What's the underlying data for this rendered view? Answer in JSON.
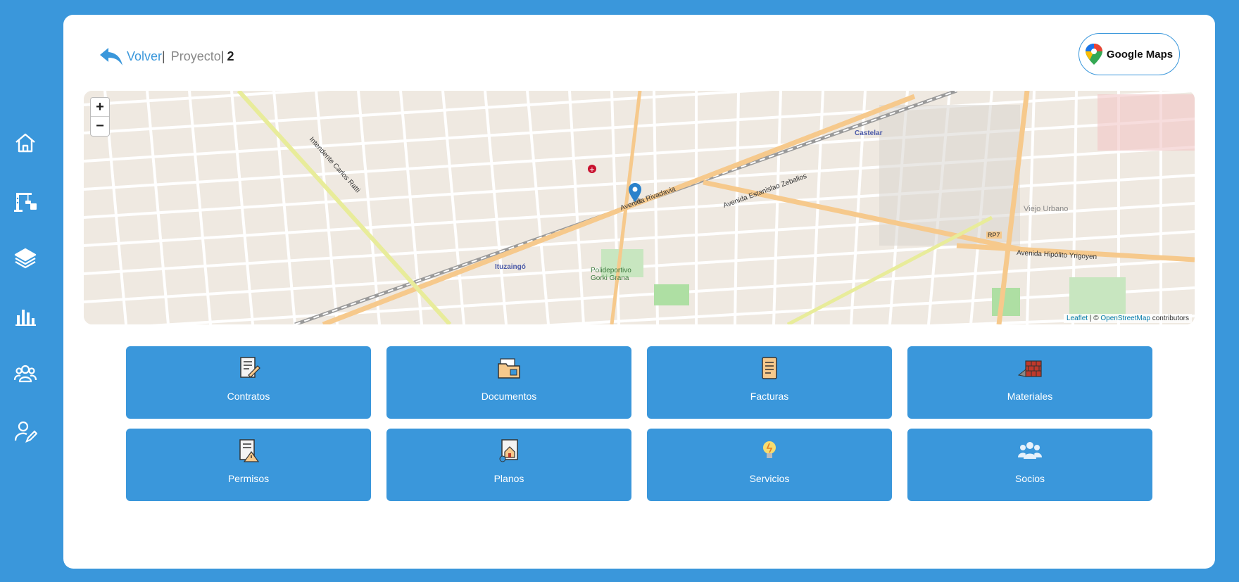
{
  "header": {
    "back_label": "Volver",
    "separator": "|",
    "project_label": "Proyecto",
    "project_number": "2",
    "google_maps_label": "Google Maps"
  },
  "sidebar": {
    "items": [
      {
        "icon": "home-icon"
      },
      {
        "icon": "construction-crane-icon"
      },
      {
        "icon": "layers-icon"
      },
      {
        "icon": "bar-chart-icon"
      },
      {
        "icon": "users-icon"
      },
      {
        "icon": "user-edit-icon"
      }
    ]
  },
  "map": {
    "zoom_in": "+",
    "zoom_out": "−",
    "attribution_leaflet": "Leaflet",
    "attribution_sep": " | © ",
    "attribution_osm": "OpenStreetMap",
    "attribution_suffix": " contributors",
    "labels": {
      "ituzaingo": "Ituzaingó",
      "castelar": "Castelar",
      "polideportivo": "Polideportivo Gorki Grana",
      "viejo_urbano": "Viejo Urbano",
      "avenida_rivadavia": "Avenida Rivadavia",
      "avenida_zeballos": "Avenida Estanislao Zeballos",
      "avenida_yrigoyen": "Avenida Hipólito Yrigoyen",
      "intendente_ratti": "Intendente Carlos Ratti",
      "rp7": "RP7"
    }
  },
  "tiles": [
    {
      "label": "Contratos",
      "icon": "contract-icon"
    },
    {
      "label": "Documentos",
      "icon": "folder-documents-icon"
    },
    {
      "label": "Facturas",
      "icon": "invoice-icon"
    },
    {
      "label": "Materiales",
      "icon": "bricks-icon"
    },
    {
      "label": "Permisos",
      "icon": "permit-icon"
    },
    {
      "label": "Planos",
      "icon": "blueprint-icon"
    },
    {
      "label": "Servicios",
      "icon": "lightbulb-icon"
    },
    {
      "label": "Socios",
      "icon": "partners-icon"
    }
  ],
  "colors": {
    "accent": "#3a97db",
    "card": "#ffffff",
    "map_bg": "#efe9e1",
    "road_major": "#f6c98c",
    "marker": "#2a81cb"
  }
}
